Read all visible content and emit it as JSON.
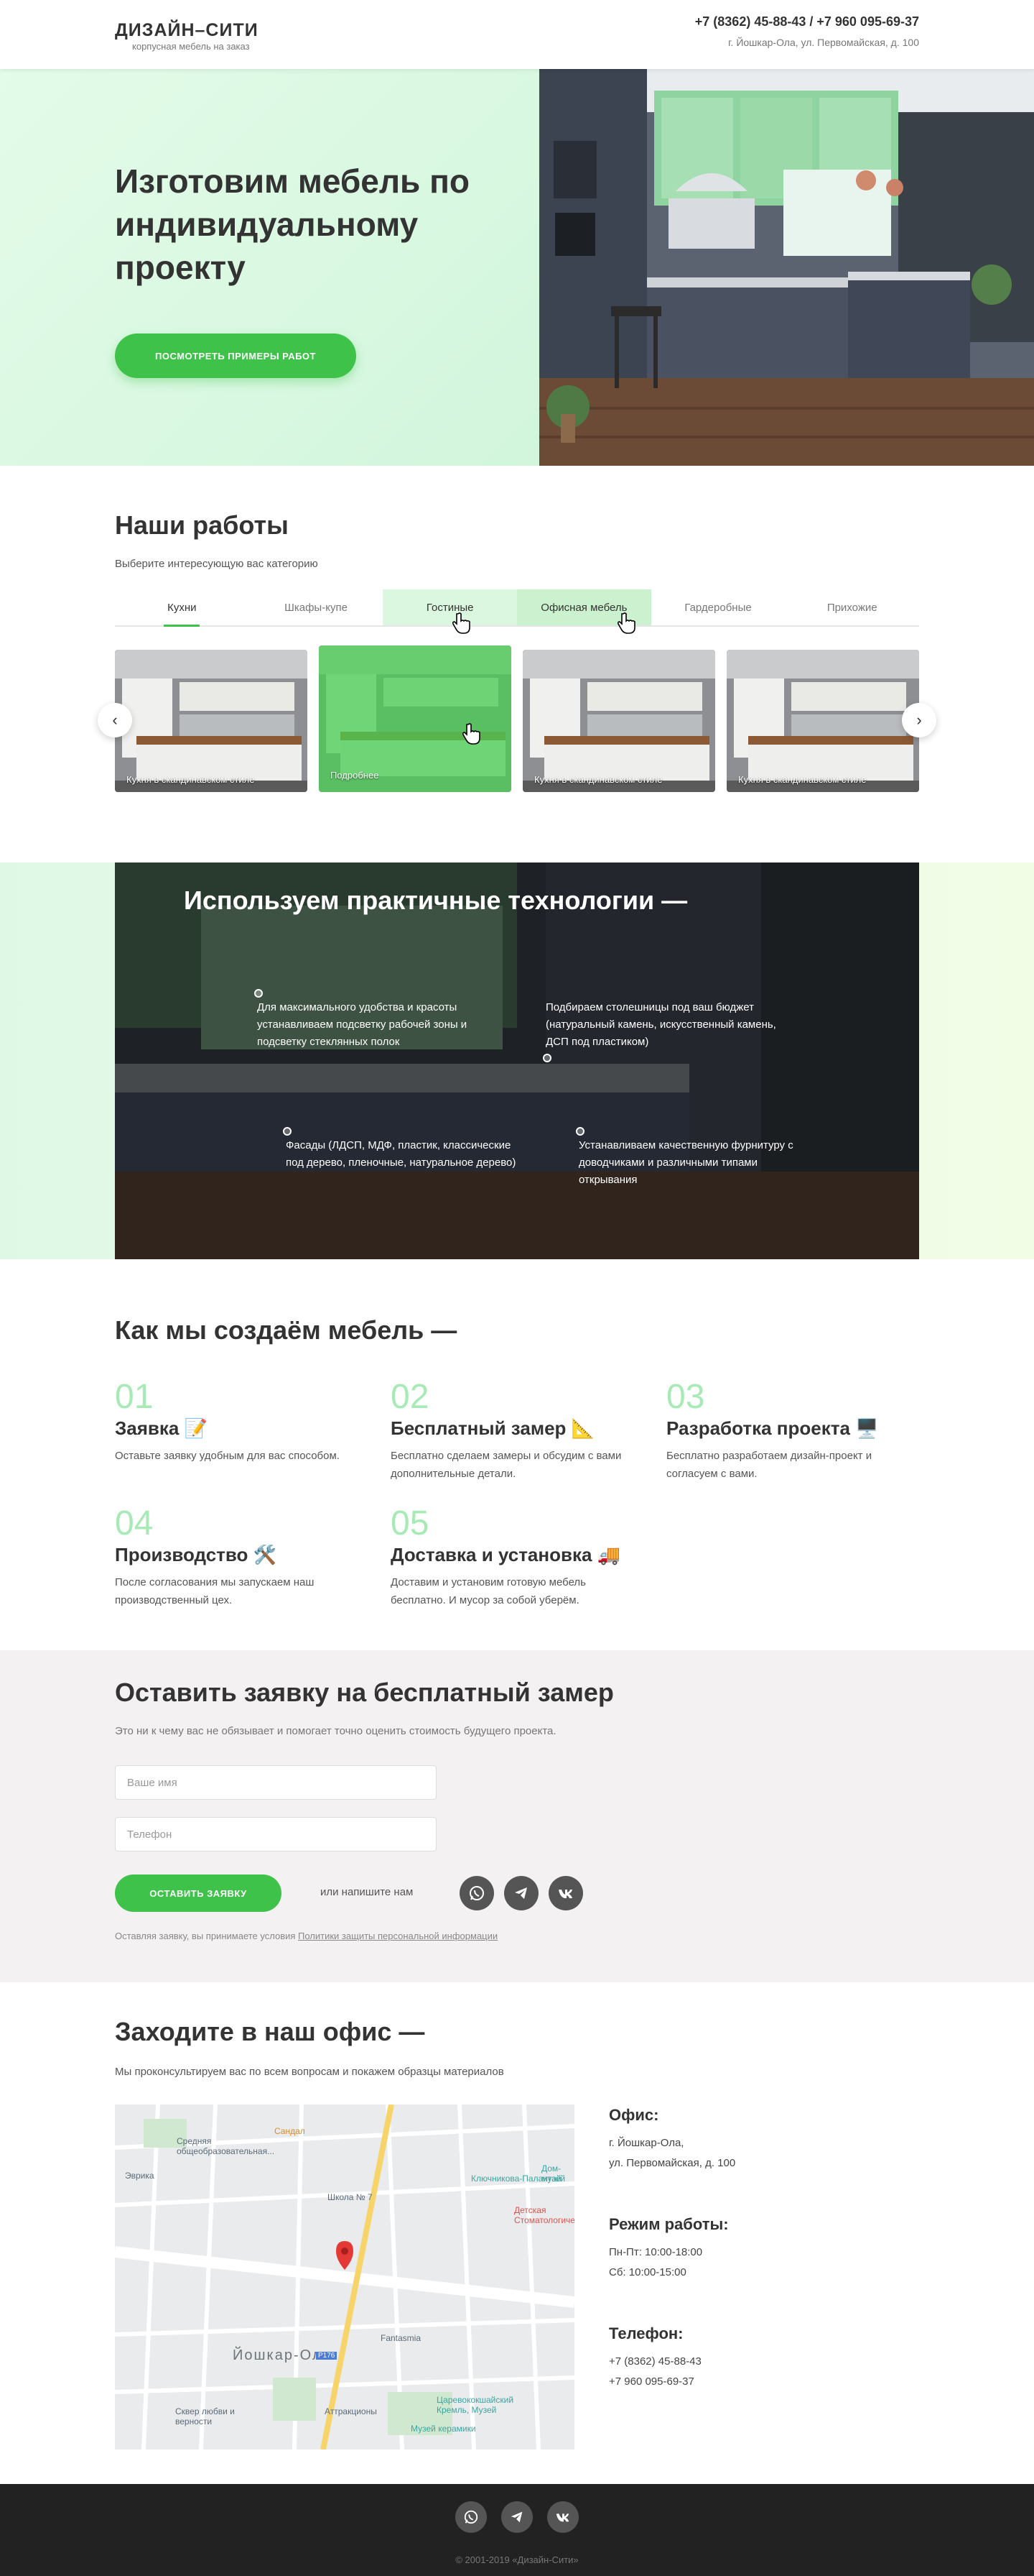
{
  "header": {
    "logo_title": "ДИЗАЙН–СИТИ",
    "logo_sub": "корпусная мебель на заказ",
    "phones": "+7 (8362) 45-88-43 / +7 960 095-69-37",
    "address": "г. Йошкар-Ола, ул. Первомайская, д. 100"
  },
  "hero": {
    "title": "Изготовим мебель по индивидуальному проекту",
    "button": "ПОСМОТРЕТЬ ПРИМЕРЫ РАБОТ"
  },
  "works": {
    "title": "Наши работы",
    "subtitle": "Выберите интересующую вас категорию",
    "tabs": [
      "Кухни",
      "Шкафы-купе",
      "Гостиные",
      "Офисная мебель",
      "Гардеробные",
      "Прихожие"
    ],
    "cards": [
      "Кухня в скандинавском стиле",
      "Подробнее",
      "Кухня в скандинавском стиле",
      "Кухня в скандинавском стиле"
    ],
    "prev": "‹",
    "next": "›"
  },
  "tech": {
    "title": "Используем практичные технологии —",
    "items": [
      "Для максимального удобства и красоты устанавливаем подсветку рабочей зоны и подсветку стеклянных полок",
      "Подбираем столешницы под ваш бюджет (натуральный камень, искусственный камень, ДСП под пластиком)",
      "Фасады (ЛДСП, МДФ, пластик, классические под дерево, пленочные, натуральное дерево)",
      "Устанавливаем качественную фурнитуру с доводчиками и различными типами открывания"
    ]
  },
  "process": {
    "title": "Как мы создаём мебель —",
    "steps": [
      {
        "num": "01",
        "title": "Заявка 📝",
        "text": "Оставьте заявку удобным для вас способом."
      },
      {
        "num": "02",
        "title": "Бесплатный замер 📐",
        "text": "Бесплатно сделаем замеры и обсудим с вами дополнительные детали."
      },
      {
        "num": "03",
        "title": "Разработка проекта 🖥️",
        "text": "Бесплатно разработаем дизайн-проект и согласуем с вами."
      },
      {
        "num": "04",
        "title": "Производство 🛠️",
        "text": "После согласования мы запускаем наш производственный цех."
      },
      {
        "num": "05",
        "title": "Доставка и установка 🚚",
        "text": "Доставим и установим готовую мебель бесплатно. И мусор за собой уберём."
      }
    ]
  },
  "form": {
    "title": "Оставить заявку на бесплатный замер",
    "subtitle": "Это ни к чему вас не обязывает и помогает точно оценить стоимость будущего проекта.",
    "name_placeholder": "Ваше имя",
    "phone_placeholder": "Телефон",
    "submit": "ОСТАВИТЬ ЗАЯВКУ",
    "or_text": "или напишите нам",
    "disclaimer": "Оставляя заявку, вы принимаете условия ",
    "policy_link": "Политики защиты персональной информации"
  },
  "office": {
    "title": "Заходите в наш офис —",
    "subtitle": "Мы проконсультируем вас по всем вопросам и покажем образцы материалов",
    "office_h": "Офис:",
    "office_l1": "г. Йошкар-Ола,",
    "office_l2": "ул. Первомайская, д. 100",
    "hours_h": "Режим работы:",
    "hours_l1": "Пн-Пт: 10:00-18:00",
    "hours_l2": "Сб: 10:00-15:00",
    "phone_h": "Телефон:",
    "phone_l1": "+7 (8362) 45-88-43",
    "phone_l2": "+7 960 095-69-37",
    "map_labels": [
      "Средняя общеобразовательная...",
      "Эврика",
      "Сандал",
      "Ключникова-Палантай",
      "Дом-музей",
      "Школа № 7",
      "Детская Стоматологическая...",
      "Fantasmia",
      "Йошкар-Ола",
      "Р176",
      "Царевококшайский Кремль, Музей",
      "Аттракционы",
      "Музей керамики",
      "Сквер любви и верности"
    ]
  },
  "footer": {
    "copyright": "© 2001-2019 «Дизайн-Сити»"
  },
  "colors": {
    "accent": "#3ec24a",
    "hero_bg": "#d6f7df",
    "footer_bg": "#222222"
  }
}
